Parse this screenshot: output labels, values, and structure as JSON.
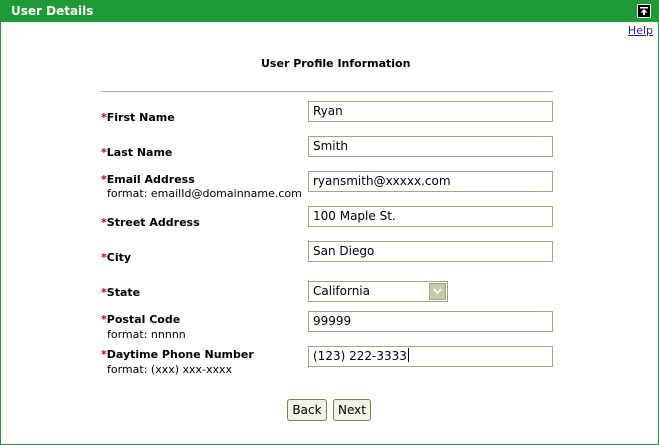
{
  "window": {
    "title": "User Details",
    "help_label": "Help",
    "accent_color": "#1e9a36"
  },
  "form": {
    "section_title": "User Profile Information",
    "required_marker": "*",
    "fields": {
      "first_name": {
        "label": "First Name",
        "value": "Ryan"
      },
      "last_name": {
        "label": "Last Name",
        "value": "Smith"
      },
      "email": {
        "label": "Email Address",
        "hint": "format: emailId@domainname.com",
        "value": "ryansmith@xxxxx.com"
      },
      "street": {
        "label": "Street Address",
        "value": "100 Maple St."
      },
      "city": {
        "label": "City",
        "value": "San Diego"
      },
      "state": {
        "label": "State",
        "selected": "California"
      },
      "postal": {
        "label": "Postal Code",
        "hint": "format: nnnnn",
        "value": "99999"
      },
      "phone": {
        "label": "Daytime Phone Number",
        "hint": "format: (xxx) xxx-xxxx",
        "value": "(123) 222-3333"
      }
    }
  },
  "buttons": {
    "back_label": "Back",
    "next_label": "Next"
  },
  "icons": {
    "collapse": "collapse-up-icon",
    "dropdown": "chevron-down-icon"
  }
}
